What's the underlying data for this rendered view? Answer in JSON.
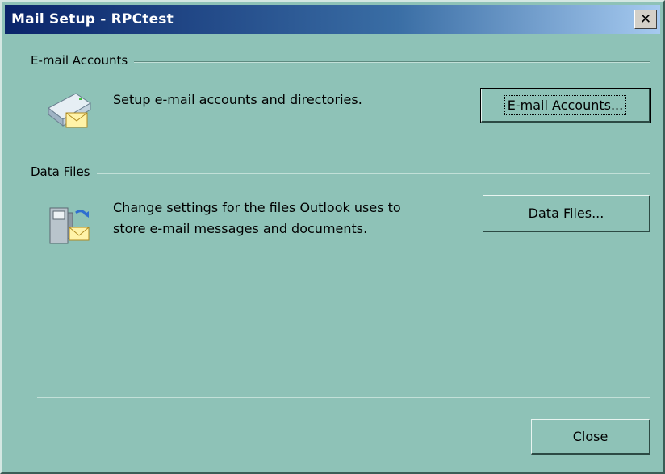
{
  "window": {
    "title": "Mail Setup - RPCtest",
    "close_glyph": "✕"
  },
  "email_accounts": {
    "group_label": "E-mail Accounts",
    "description": "Setup e-mail accounts and directories.",
    "button_label": "E-mail Accounts...",
    "icon": "mail-server-icon"
  },
  "data_files": {
    "group_label": "Data Files",
    "description_line1": "Change settings for the files Outlook uses to",
    "description_line2": "store e-mail messages and documents.",
    "button_label": "Data Files...",
    "icon": "mailbox-icon"
  },
  "footer": {
    "close_label": "Close"
  },
  "colors": {
    "background": "#8ec2b7",
    "title_bar_start": "#0a246a",
    "title_bar_end": "#a6caf0"
  }
}
